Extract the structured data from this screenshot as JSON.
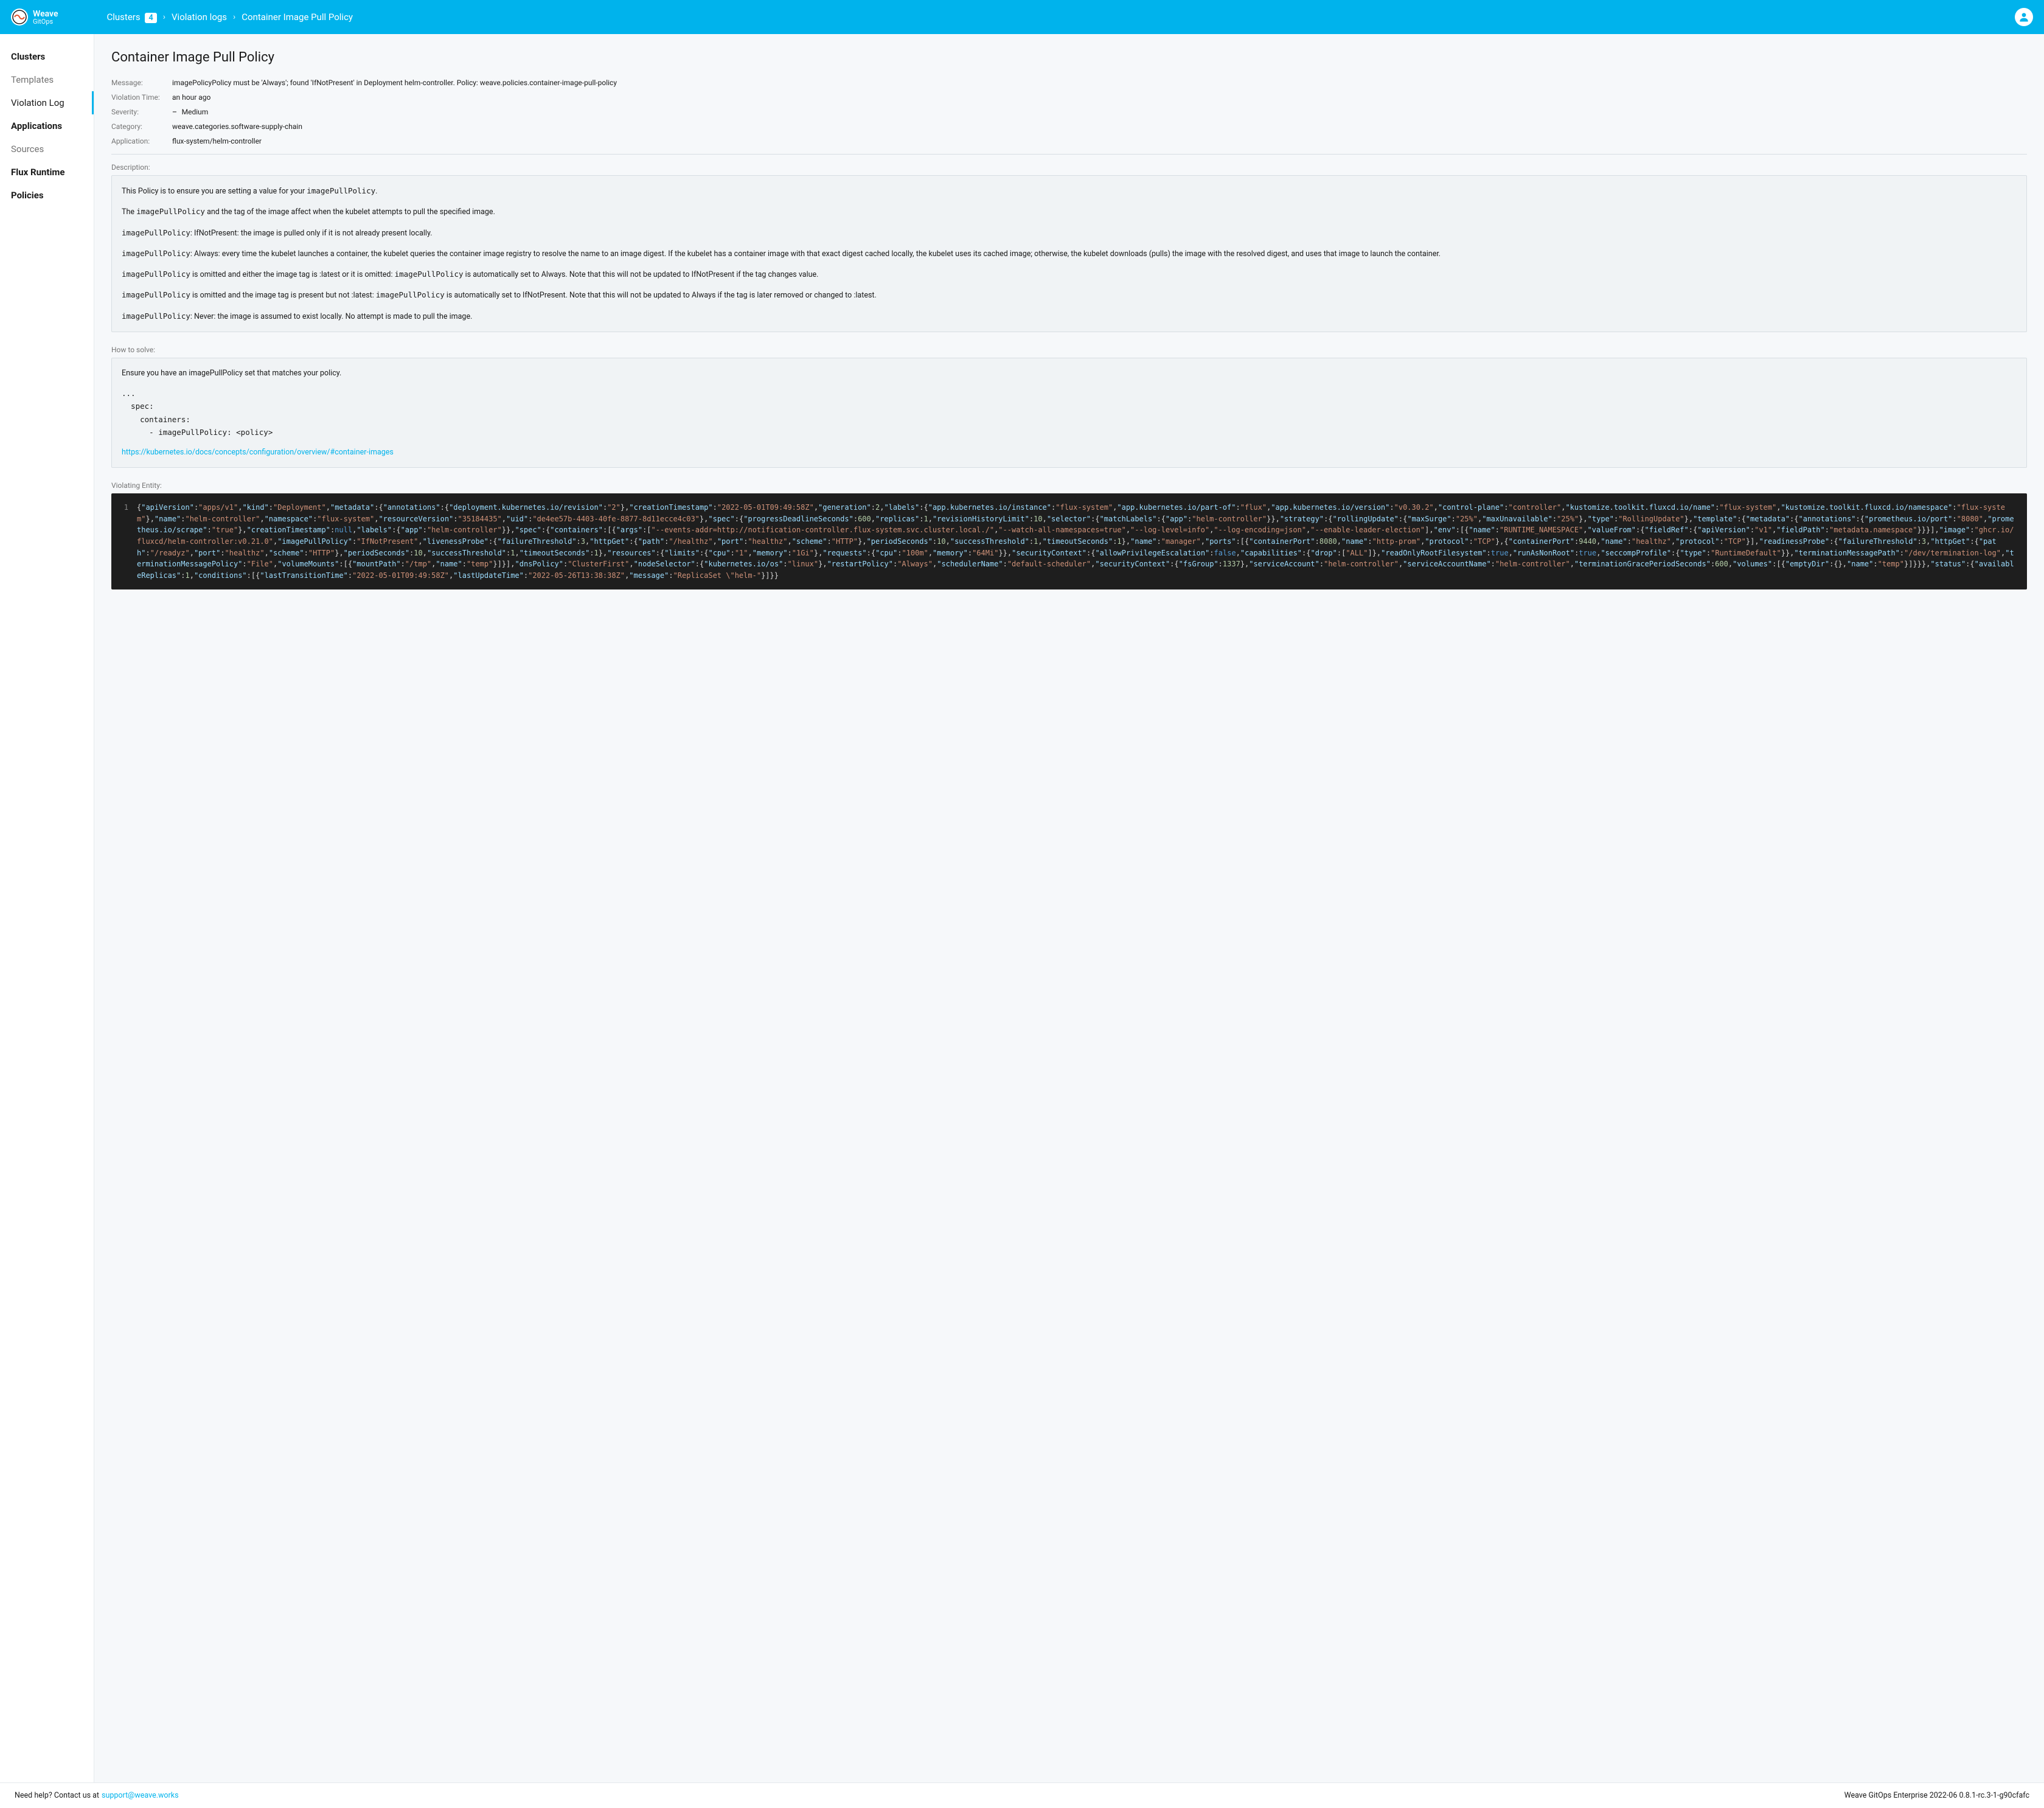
{
  "brand": {
    "name": "Weave",
    "sub": "GitOps"
  },
  "breadcrumb": {
    "items": [
      {
        "label": "Clusters",
        "badge": "4"
      },
      {
        "label": "Violation logs"
      },
      {
        "label": "Container Image Pull Policy"
      }
    ]
  },
  "sidebar": {
    "sections": [
      {
        "label": "Clusters",
        "type": "section"
      },
      {
        "label": "Templates",
        "type": "sub"
      },
      {
        "label": "Violation Log",
        "type": "sub",
        "active": true
      },
      {
        "label": "Applications",
        "type": "section"
      },
      {
        "label": "Sources",
        "type": "sub"
      },
      {
        "label": "Flux Runtime",
        "type": "section"
      },
      {
        "label": "Policies",
        "type": "section"
      }
    ]
  },
  "page": {
    "title": "Container Image Pull Policy",
    "meta": {
      "message_label": "Message:",
      "message": "imagePolicyPolicy must be 'Always'; found 'IfNotPresent' in Deployment helm-controller. Policy: weave.policies.container-image-pull-policy",
      "violation_time_label": "Violation Time:",
      "violation_time": "an hour ago",
      "severity_label": "Severity:",
      "severity": "Medium",
      "category_label": "Category:",
      "category": "weave.categories.software-supply-chain",
      "application_label": "Application:",
      "application": "flux-system/helm-controller"
    },
    "description": {
      "label": "Description:",
      "p1_a": "This Policy is to ensure you are setting a value for your ",
      "p1_code": "imagePullPolicy",
      "p1_b": ".",
      "p2_a": "The ",
      "p2_code": "imagePullPolicy",
      "p2_b": " and the tag of the image affect when the kubelet attempts to pull the specified image.",
      "p3_code": "imagePullPolicy",
      "p3": ": IfNotPresent: the image is pulled only if it is not already present locally.",
      "p4_code": "imagePullPolicy",
      "p4": ": Always: every time the kubelet launches a container, the kubelet queries the container image registry to resolve the name to an image digest. If the kubelet has a container image with that exact digest cached locally, the kubelet uses its cached image; otherwise, the kubelet downloads (pulls) the image with the resolved digest, and uses that image to launch the container.",
      "p5_code1": "imagePullPolicy",
      "p5_a": " is omitted and either the image tag is :latest or it is omitted: ",
      "p5_code2": "imagePullPolicy",
      "p5_b": " is automatically set to Always. Note that this will not be updated to IfNotPresent if the tag changes value.",
      "p6_code1": "imagePullPolicy",
      "p6_a": " is omitted and the image tag is present but not :latest: ",
      "p6_code2": "imagePullPolicy",
      "p6_b": " is automatically set to IfNotPresent. Note that this will not be updated to Always if the tag is later removed or changed to :latest.",
      "p7_code": "imagePullPolicy",
      "p7": ": Never: the image is assumed to exist locally. No attempt is made to pull the image."
    },
    "how_to_solve": {
      "label": "How to solve:",
      "intro": "Ensure you have an imagePullPolicy set that matches your policy.",
      "snippet": "...\n  spec:\n    containers:\n      - imagePullPolicy: <policy>",
      "link_text": "https://kubernetes.io/docs/concepts/configuration/overview/#container-images",
      "link_href": "https://kubernetes.io/docs/concepts/configuration/overview/#container-images"
    },
    "violating_entity": {
      "label": "Violating Entity:",
      "line_number": "1",
      "json": {
        "apiVersion": "apps/v1",
        "kind": "Deployment",
        "metadata": {
          "annotations": {
            "deployment.kubernetes.io/revision": "2"
          },
          "creationTimestamp": "2022-05-01T09:49:58Z",
          "generation": 2,
          "labels": {
            "app.kubernetes.io/instance": "flux-system",
            "app.kubernetes.io/part-of": "flux",
            "app.kubernetes.io/version": "v0.30.2",
            "control-plane": "controller",
            "kustomize.toolkit.fluxcd.io/name": "flux-system",
            "kustomize.toolkit.fluxcd.io/namespace": "flux-system"
          },
          "name": "helm-controller",
          "namespace": "flux-system",
          "resourceVersion": "35184435",
          "uid": "de4ee57b-4403-40fe-8877-8d11ecce4c03"
        },
        "spec": {
          "progressDeadlineSeconds": 600,
          "replicas": 1,
          "revisionHistoryLimit": 10,
          "selector": {
            "matchLabels": {
              "app": "helm-controller"
            }
          },
          "strategy": {
            "rollingUpdate": {
              "maxSurge": "25%",
              "maxUnavailable": "25%"
            },
            "type": "RollingUpdate"
          },
          "template": {
            "metadata": {
              "annotations": {
                "prometheus.io/port": "8080",
                "prometheus.io/scrape": "true"
              },
              "creationTimestamp": null,
              "labels": {
                "app": "helm-controller"
              }
            },
            "spec": {
              "containers": [
                {
                  "args": [
                    "--events-addr=http://notification-controller.flux-system.svc.cluster.local./",
                    "--watch-all-namespaces=true",
                    "--log-level=info",
                    "--log-encoding=json",
                    "--enable-leader-election"
                  ],
                  "env": [
                    {
                      "name": "RUNTIME_NAMESPACE",
                      "valueFrom": {
                        "fieldRef": {
                          "apiVersion": "v1",
                          "fieldPath": "metadata.namespace"
                        }
                      }
                    }
                  ],
                  "image": "ghcr.io/fluxcd/helm-controller:v0.21.0",
                  "imagePullPolicy": "IfNotPresent",
                  "livenessProbe": {
                    "failureThreshold": 3,
                    "httpGet": {
                      "path": "/healthz",
                      "port": "healthz",
                      "scheme": "HTTP"
                    },
                    "periodSeconds": 10,
                    "successThreshold": 1,
                    "timeoutSeconds": 1
                  },
                  "name": "manager",
                  "ports": [
                    {
                      "containerPort": 8080,
                      "name": "http-prom",
                      "protocol": "TCP"
                    },
                    {
                      "containerPort": 9440,
                      "name": "healthz",
                      "protocol": "TCP"
                    }
                  ],
                  "readinessProbe": {
                    "failureThreshold": 3,
                    "httpGet": {
                      "path": "/readyz",
                      "port": "healthz",
                      "scheme": "HTTP"
                    },
                    "periodSeconds": 10,
                    "successThreshold": 1,
                    "timeoutSeconds": 1
                  },
                  "resources": {
                    "limits": {
                      "cpu": "1",
                      "memory": "1Gi"
                    },
                    "requests": {
                      "cpu": "100m",
                      "memory": "64Mi"
                    }
                  },
                  "securityContext": {
                    "allowPrivilegeEscalation": false,
                    "capabilities": {
                      "drop": [
                        "ALL"
                      ]
                    },
                    "readOnlyRootFilesystem": true,
                    "runAsNonRoot": true,
                    "seccompProfile": {
                      "type": "RuntimeDefault"
                    }
                  },
                  "terminationMessagePath": "/dev/termination-log",
                  "terminationMessagePolicy": "File",
                  "volumeMounts": [
                    {
                      "mountPath": "/tmp",
                      "name": "temp"
                    }
                  ]
                }
              ],
              "dnsPolicy": "ClusterFirst",
              "nodeSelector": {
                "kubernetes.io/os": "linux"
              },
              "restartPolicy": "Always",
              "schedulerName": "default-scheduler",
              "securityContext": {
                "fsGroup": 1337
              },
              "serviceAccount": "helm-controller",
              "serviceAccountName": "helm-controller",
              "terminationGracePeriodSeconds": 600,
              "volumes": [
                {
                  "emptyDir": {},
                  "name": "temp"
                }
              ]
            }
          }
        },
        "status": {
          "availableReplicas": 1,
          "conditions": [
            {
              "lastTransitionTime": "2022-05-01T09:49:58Z",
              "lastUpdateTime": "2022-05-26T13:38:38Z",
              "message": "ReplicaSet \"helm-"
            }
          ]
        }
      }
    }
  },
  "footer": {
    "help_text": "Need help? Contact us at",
    "email": "support@weave.works",
    "version": "Weave GitOps Enterprise 2022-06 0.8.1-rc.3-1-g90cfafc"
  }
}
